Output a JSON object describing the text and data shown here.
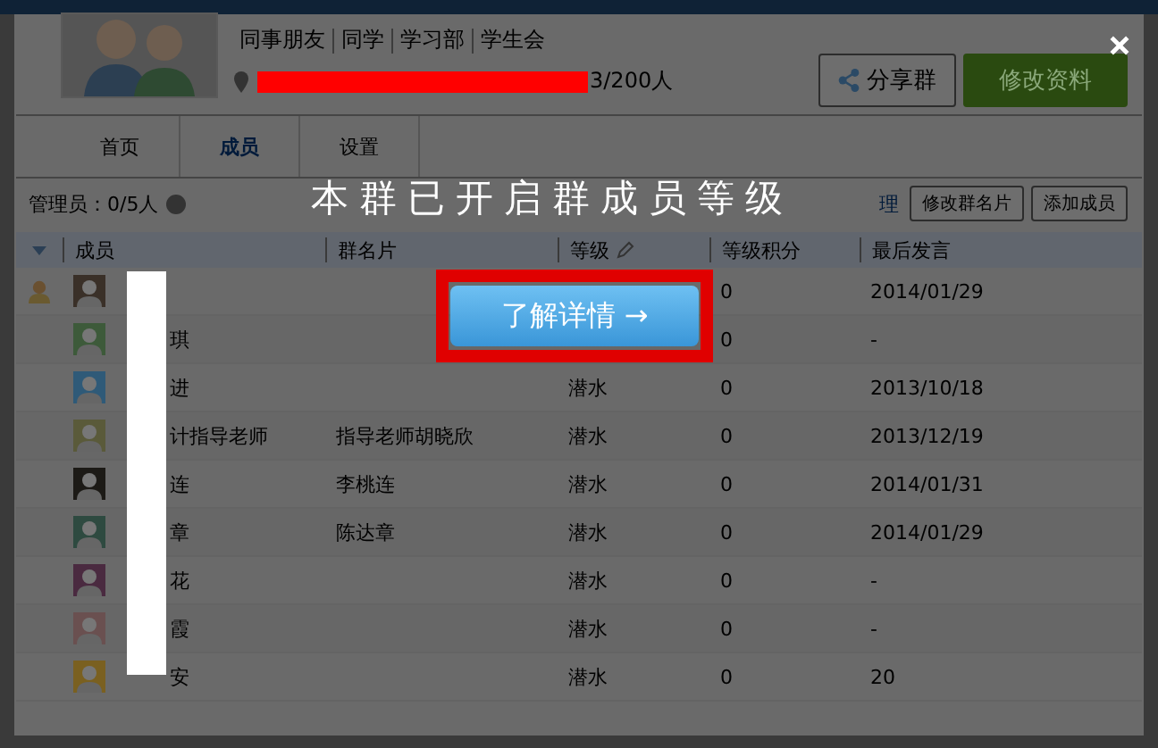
{
  "header": {
    "tags": [
      "同事朋友",
      "同学",
      "学习部",
      "学生会"
    ],
    "member_count": "3/200人",
    "buttons": [
      {
        "label": "分享群",
        "kind": "share"
      },
      {
        "label": "修改资料",
        "kind": "primary"
      }
    ]
  },
  "tabs": [
    {
      "label": "首页",
      "selected": false
    },
    {
      "label": "成员",
      "selected": true
    },
    {
      "label": "设置",
      "selected": false
    }
  ],
  "toolbar": {
    "admins": "管理员：0/5人",
    "link": "理",
    "buttons": [
      "修改群名片",
      "添加成员"
    ]
  },
  "table": {
    "columns": [
      "成员",
      "群名片",
      "等级",
      "等级积分",
      "最后发言"
    ],
    "rows": [
      {
        "owner": true,
        "points": "0",
        "last": "2014/01/29"
      },
      {
        "owner": false,
        "name": "琪",
        "points": "0",
        "last": "-"
      },
      {
        "owner": false,
        "name": "进",
        "level_name": "潜水",
        "points": "0",
        "last": "2013/10/18"
      },
      {
        "owner": false,
        "name": "计指导老师",
        "card": "指导老师胡晓欣",
        "level_name": "潜水",
        "points": "0",
        "last": "2013/12/19"
      },
      {
        "owner": false,
        "name": "连",
        "card": "李桃连",
        "level_name": "潜水",
        "points": "0",
        "last": "2014/01/31"
      },
      {
        "owner": false,
        "name": "章",
        "card": "陈达章",
        "level_name": "潜水",
        "points": "0",
        "last": "2014/01/29"
      },
      {
        "owner": false,
        "name": "花",
        "level_name": "潜水",
        "points": "0",
        "last": "-"
      },
      {
        "owner": false,
        "name": "霞",
        "level_name": "潜水",
        "points": "0",
        "last": "-"
      },
      {
        "owner": false,
        "name": "安",
        "level_name": "潜水",
        "points": "0",
        "last": "20"
      }
    ]
  },
  "notice": {
    "caption": "本群已开启群成员等级",
    "button": "了解详情 →"
  }
}
